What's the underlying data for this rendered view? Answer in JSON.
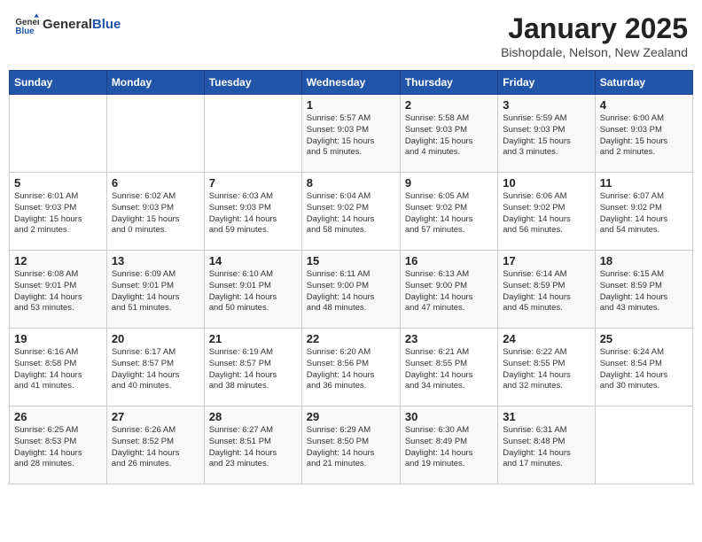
{
  "header": {
    "logo_general": "General",
    "logo_blue": "Blue",
    "month_title": "January 2025",
    "location": "Bishopdale, Nelson, New Zealand"
  },
  "weekdays": [
    "Sunday",
    "Monday",
    "Tuesday",
    "Wednesday",
    "Thursday",
    "Friday",
    "Saturday"
  ],
  "weeks": [
    [
      {
        "day": "",
        "info": ""
      },
      {
        "day": "",
        "info": ""
      },
      {
        "day": "",
        "info": ""
      },
      {
        "day": "1",
        "info": "Sunrise: 5:57 AM\nSunset: 9:03 PM\nDaylight: 15 hours\nand 5 minutes."
      },
      {
        "day": "2",
        "info": "Sunrise: 5:58 AM\nSunset: 9:03 PM\nDaylight: 15 hours\nand 4 minutes."
      },
      {
        "day": "3",
        "info": "Sunrise: 5:59 AM\nSunset: 9:03 PM\nDaylight: 15 hours\nand 3 minutes."
      },
      {
        "day": "4",
        "info": "Sunrise: 6:00 AM\nSunset: 9:03 PM\nDaylight: 15 hours\nand 2 minutes."
      }
    ],
    [
      {
        "day": "5",
        "info": "Sunrise: 6:01 AM\nSunset: 9:03 PM\nDaylight: 15 hours\nand 2 minutes."
      },
      {
        "day": "6",
        "info": "Sunrise: 6:02 AM\nSunset: 9:03 PM\nDaylight: 15 hours\nand 0 minutes."
      },
      {
        "day": "7",
        "info": "Sunrise: 6:03 AM\nSunset: 9:03 PM\nDaylight: 14 hours\nand 59 minutes."
      },
      {
        "day": "8",
        "info": "Sunrise: 6:04 AM\nSunset: 9:02 PM\nDaylight: 14 hours\nand 58 minutes."
      },
      {
        "day": "9",
        "info": "Sunrise: 6:05 AM\nSunset: 9:02 PM\nDaylight: 14 hours\nand 57 minutes."
      },
      {
        "day": "10",
        "info": "Sunrise: 6:06 AM\nSunset: 9:02 PM\nDaylight: 14 hours\nand 56 minutes."
      },
      {
        "day": "11",
        "info": "Sunrise: 6:07 AM\nSunset: 9:02 PM\nDaylight: 14 hours\nand 54 minutes."
      }
    ],
    [
      {
        "day": "12",
        "info": "Sunrise: 6:08 AM\nSunset: 9:01 PM\nDaylight: 14 hours\nand 53 minutes."
      },
      {
        "day": "13",
        "info": "Sunrise: 6:09 AM\nSunset: 9:01 PM\nDaylight: 14 hours\nand 51 minutes."
      },
      {
        "day": "14",
        "info": "Sunrise: 6:10 AM\nSunset: 9:01 PM\nDaylight: 14 hours\nand 50 minutes."
      },
      {
        "day": "15",
        "info": "Sunrise: 6:11 AM\nSunset: 9:00 PM\nDaylight: 14 hours\nand 48 minutes."
      },
      {
        "day": "16",
        "info": "Sunrise: 6:13 AM\nSunset: 9:00 PM\nDaylight: 14 hours\nand 47 minutes."
      },
      {
        "day": "17",
        "info": "Sunrise: 6:14 AM\nSunset: 8:59 PM\nDaylight: 14 hours\nand 45 minutes."
      },
      {
        "day": "18",
        "info": "Sunrise: 6:15 AM\nSunset: 8:59 PM\nDaylight: 14 hours\nand 43 minutes."
      }
    ],
    [
      {
        "day": "19",
        "info": "Sunrise: 6:16 AM\nSunset: 8:58 PM\nDaylight: 14 hours\nand 41 minutes."
      },
      {
        "day": "20",
        "info": "Sunrise: 6:17 AM\nSunset: 8:57 PM\nDaylight: 14 hours\nand 40 minutes."
      },
      {
        "day": "21",
        "info": "Sunrise: 6:19 AM\nSunset: 8:57 PM\nDaylight: 14 hours\nand 38 minutes."
      },
      {
        "day": "22",
        "info": "Sunrise: 6:20 AM\nSunset: 8:56 PM\nDaylight: 14 hours\nand 36 minutes."
      },
      {
        "day": "23",
        "info": "Sunrise: 6:21 AM\nSunset: 8:55 PM\nDaylight: 14 hours\nand 34 minutes."
      },
      {
        "day": "24",
        "info": "Sunrise: 6:22 AM\nSunset: 8:55 PM\nDaylight: 14 hours\nand 32 minutes."
      },
      {
        "day": "25",
        "info": "Sunrise: 6:24 AM\nSunset: 8:54 PM\nDaylight: 14 hours\nand 30 minutes."
      }
    ],
    [
      {
        "day": "26",
        "info": "Sunrise: 6:25 AM\nSunset: 8:53 PM\nDaylight: 14 hours\nand 28 minutes."
      },
      {
        "day": "27",
        "info": "Sunrise: 6:26 AM\nSunset: 8:52 PM\nDaylight: 14 hours\nand 26 minutes."
      },
      {
        "day": "28",
        "info": "Sunrise: 6:27 AM\nSunset: 8:51 PM\nDaylight: 14 hours\nand 23 minutes."
      },
      {
        "day": "29",
        "info": "Sunrise: 6:29 AM\nSunset: 8:50 PM\nDaylight: 14 hours\nand 21 minutes."
      },
      {
        "day": "30",
        "info": "Sunrise: 6:30 AM\nSunset: 8:49 PM\nDaylight: 14 hours\nand 19 minutes."
      },
      {
        "day": "31",
        "info": "Sunrise: 6:31 AM\nSunset: 8:48 PM\nDaylight: 14 hours\nand 17 minutes."
      },
      {
        "day": "",
        "info": ""
      }
    ]
  ]
}
